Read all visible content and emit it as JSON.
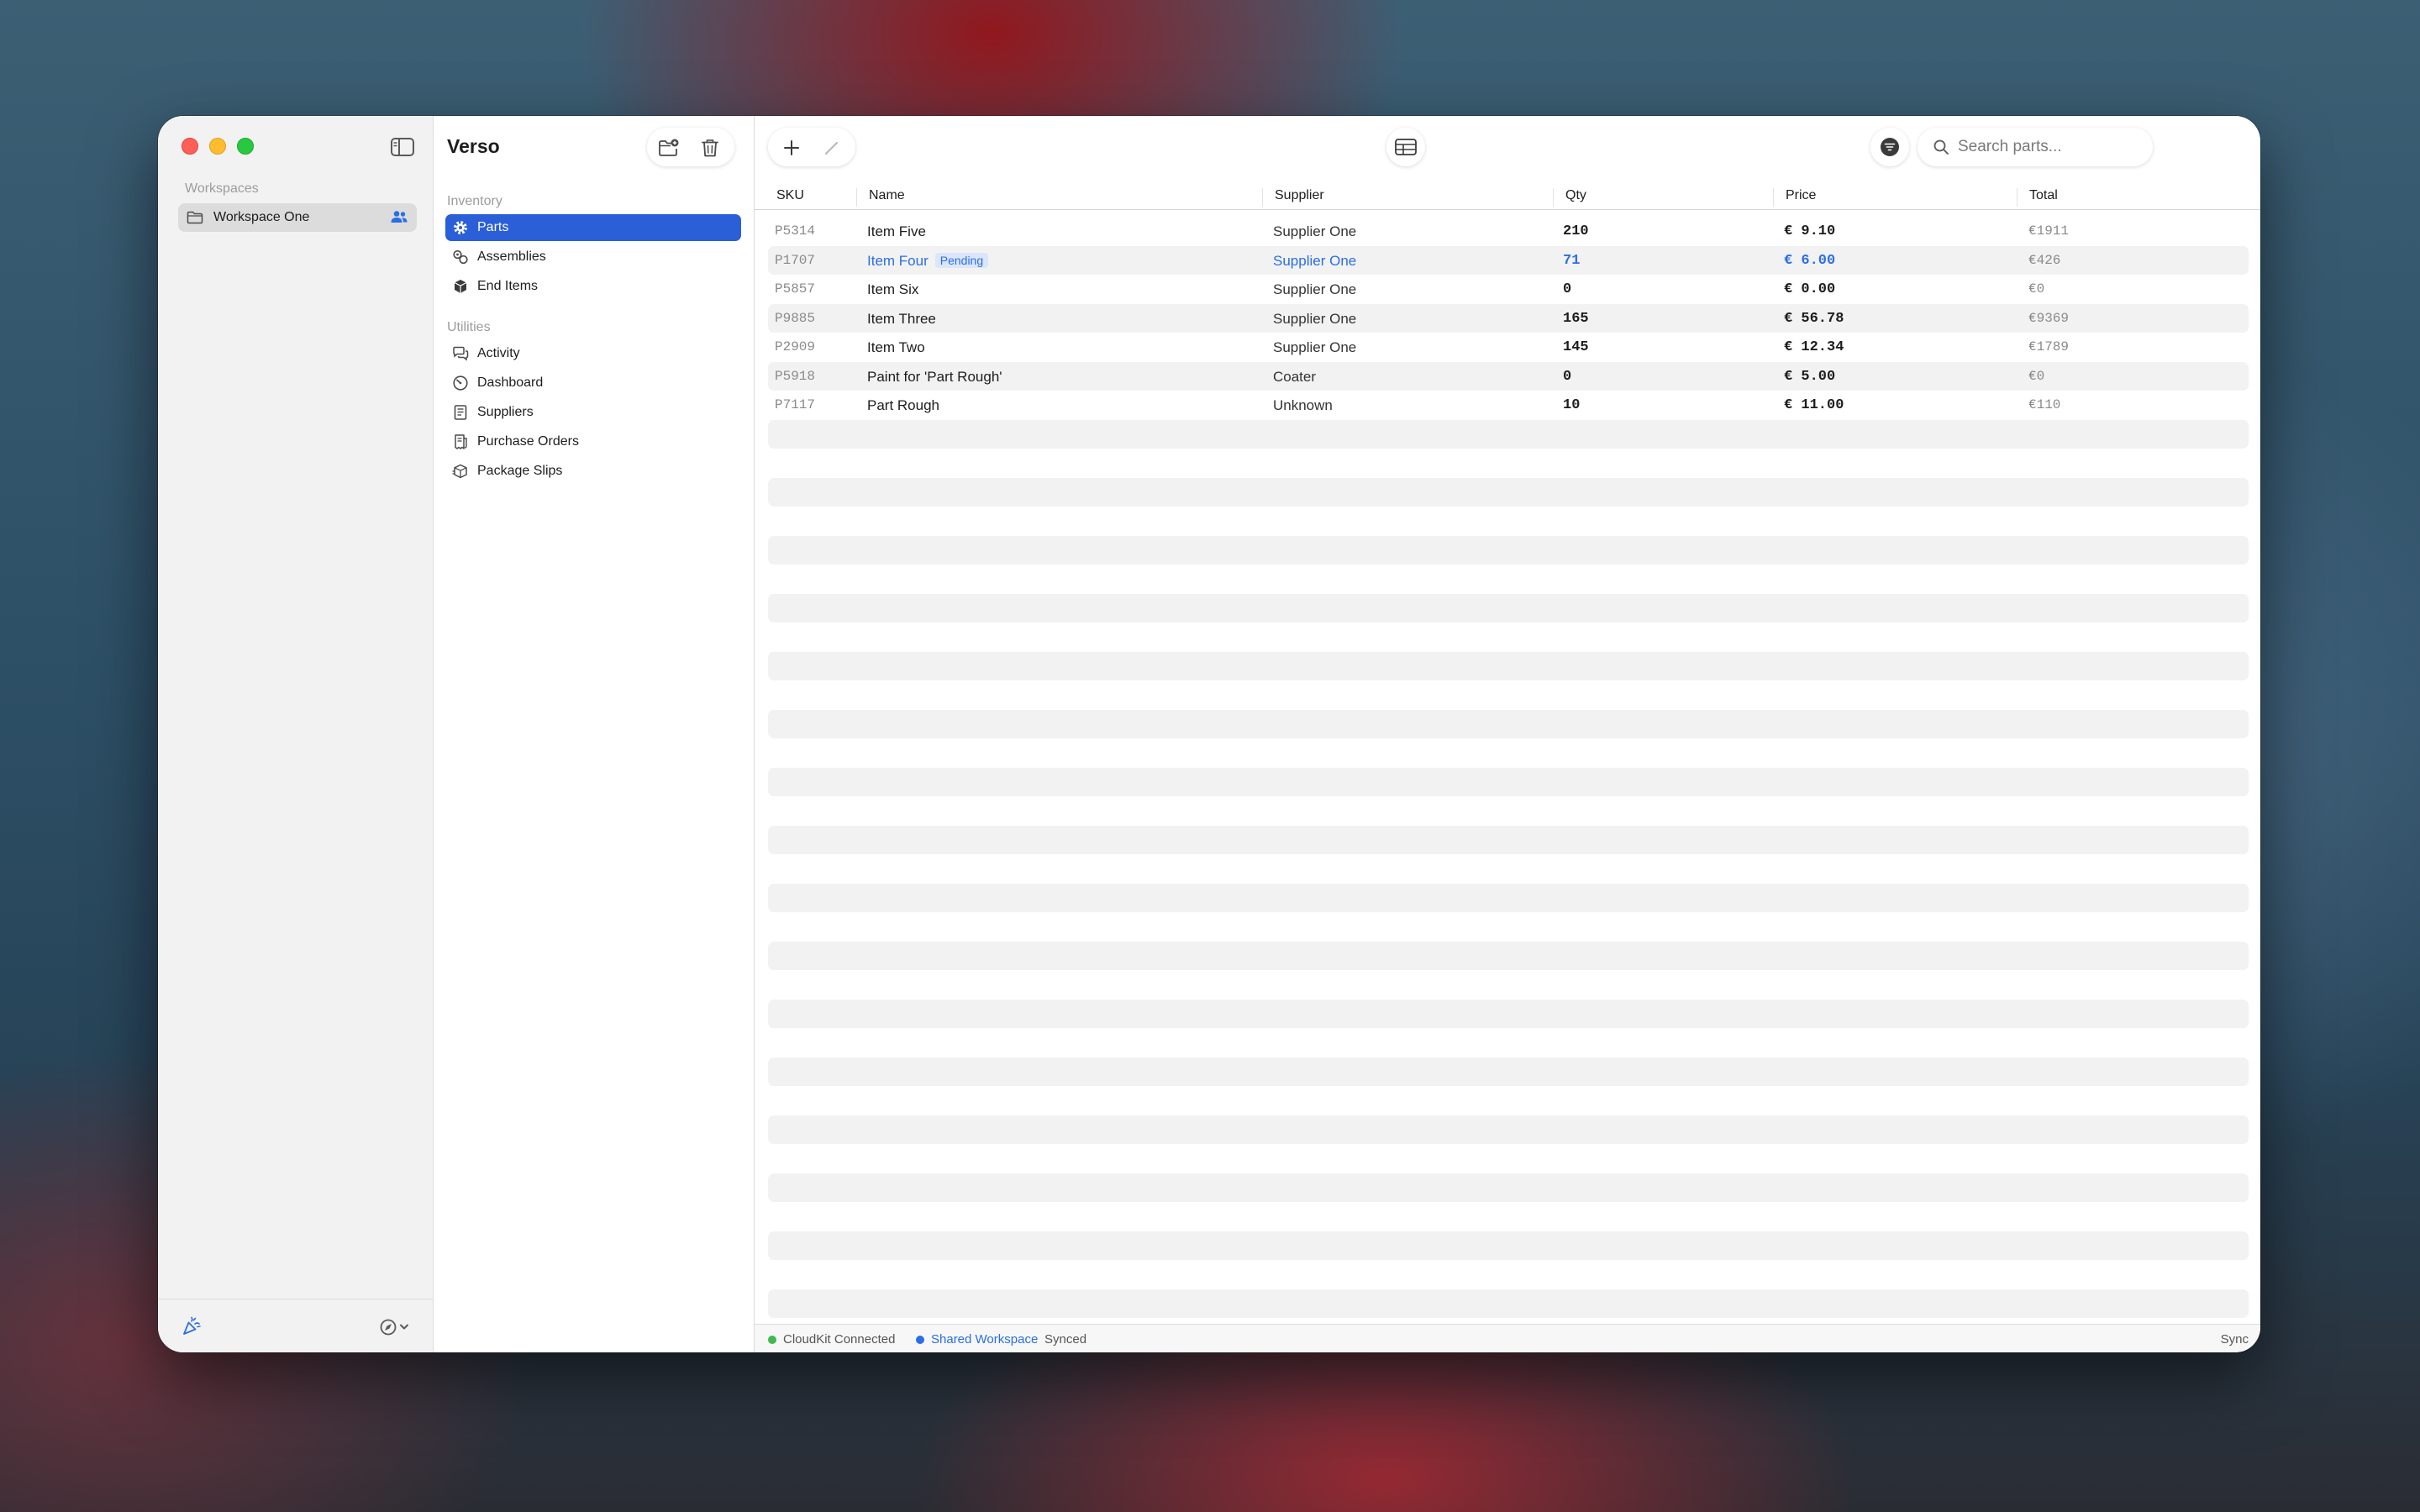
{
  "sidebar": {
    "section_label": "Workspaces",
    "workspace_name": "Workspace One"
  },
  "app": {
    "title": "Verso"
  },
  "nav": {
    "inventory_label": "Inventory",
    "inventory_items": [
      {
        "label": "Parts",
        "icon": "gear-icon",
        "active": true
      },
      {
        "label": "Assemblies",
        "icon": "link-icon",
        "active": false
      },
      {
        "label": "End Items",
        "icon": "cube-icon",
        "active": false
      }
    ],
    "utilities_label": "Utilities",
    "utility_items": [
      {
        "label": "Activity",
        "icon": "chat-bubbles-icon"
      },
      {
        "label": "Dashboard",
        "icon": "gauge-icon"
      },
      {
        "label": "Suppliers",
        "icon": "building-icon"
      },
      {
        "label": "Purchase Orders",
        "icon": "receipt-icon"
      },
      {
        "label": "Package Slips",
        "icon": "shipping-box-icon"
      }
    ]
  },
  "search": {
    "placeholder": "Search parts..."
  },
  "table": {
    "columns": [
      "SKU",
      "Name",
      "Supplier",
      "Qty",
      "Price",
      "Total"
    ],
    "rows": [
      {
        "sku": "P5314",
        "name": "Item Five",
        "badge": "",
        "supplier": "Supplier One",
        "qty": "210",
        "price": "€ 9.10",
        "total": "€1911"
      },
      {
        "sku": "P1707",
        "name": "Item Four",
        "badge": "Pending",
        "supplier": "Supplier One",
        "qty": "71",
        "price": "€ 6.00",
        "total": "€426"
      },
      {
        "sku": "P5857",
        "name": "Item Six",
        "badge": "",
        "supplier": "Supplier One",
        "qty": "0",
        "price": "€ 0.00",
        "total": "€0"
      },
      {
        "sku": "P9885",
        "name": "Item Three",
        "badge": "",
        "supplier": "Supplier One",
        "qty": "165",
        "price": "€ 56.78",
        "total": "€9369"
      },
      {
        "sku": "P2909",
        "name": "Item Two",
        "badge": "",
        "supplier": "Supplier One",
        "qty": "145",
        "price": "€ 12.34",
        "total": "€1789"
      },
      {
        "sku": "P5918",
        "name": "Paint for 'Part Rough'",
        "badge": "",
        "supplier": "Coater",
        "qty": "0",
        "price": "€ 5.00",
        "total": "€0"
      },
      {
        "sku": "P7117",
        "name": "Part Rough",
        "badge": "",
        "supplier": "Unknown",
        "qty": "10",
        "price": "€ 11.00",
        "total": "€110"
      }
    ]
  },
  "status": {
    "cloudkit": "CloudKit Connected",
    "workspace": "Shared Workspace",
    "sync_state": "Synced",
    "sync_button": "Sync"
  },
  "colors": {
    "accent": "#2a5fd8",
    "link": "#2a6ee6",
    "connected": "#3fb950"
  }
}
